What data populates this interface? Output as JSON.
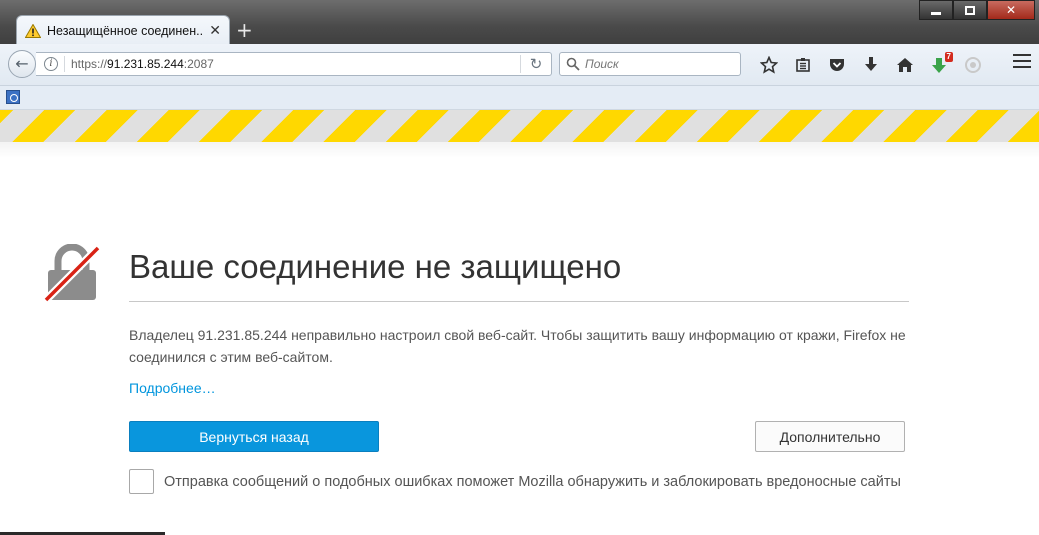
{
  "tab": {
    "title": "Незащищённое соединен...",
    "close_glyph": "✕",
    "new_tab_glyph": "+"
  },
  "window_controls": {
    "close_glyph": "✕"
  },
  "navbar": {
    "back_glyph": "←",
    "url_scheme": "https://",
    "url_host": "91.231.85.244",
    "url_port": ":2087",
    "reload_glyph": "↻",
    "search_placeholder": "Поиск",
    "extension_badge": "7"
  },
  "icons": {
    "tab": "warning-triangle-icon",
    "lock": "broken-lock-icon",
    "toolbar": [
      "bookmark-star-icon",
      "reading-list-icon",
      "pocket-icon",
      "download-icon",
      "home-icon",
      "extension-icon",
      "sync-icon",
      "menu-icon"
    ]
  },
  "error": {
    "title": "Ваше соединение не защищено",
    "description": "Владелец 91.231.85.244 неправильно настроил свой веб-сайт. Чтобы защитить вашу информацию от кражи, Firefox не соединился с этим веб-сайтом.",
    "learn_more": "Подробнее…",
    "go_back": "Вернуться назад",
    "advanced": "Дополнительно",
    "report_label": "Отправка сообщений о подобных ошибках поможет Mozilla обнаружить и заблокировать вредоносные сайты"
  },
  "colors": {
    "stripe_yellow": "#ffd800",
    "primary_blue": "#0996dd",
    "link_blue": "#0095dd",
    "lock_slash_red": "#d92215"
  }
}
